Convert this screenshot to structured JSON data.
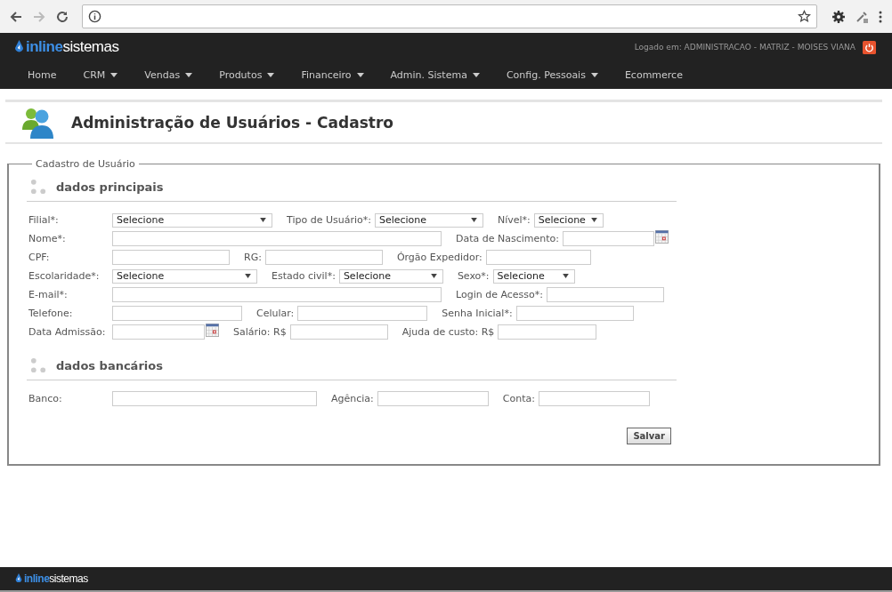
{
  "header": {
    "logo": "**inline**sistemas",
    "logged_in": "Logado em: ADMINISTRACAO - MATRIZ - MOISES VIANA"
  },
  "nav": [
    {
      "label": "Home",
      "has_menu": false
    },
    {
      "label": "CRM",
      "has_menu": true
    },
    {
      "label": "Vendas",
      "has_menu": true
    },
    {
      "label": "Produtos",
      "has_menu": true
    },
    {
      "label": "Financeiro",
      "has_menu": true
    },
    {
      "label": "Admin. Sistema",
      "has_menu": true
    },
    {
      "label": "Config. Pessoais",
      "has_menu": true
    },
    {
      "label": "Ecommerce",
      "has_menu": false
    }
  ],
  "page_title": "Administração de Usuários - Cadastro",
  "form": {
    "legend": "Cadastro de Usuário",
    "sections": [
      {
        "title": "dados principais",
        "rows": [
          [
            {
              "label": "Filial*:",
              "kind": "select",
              "value": "Selecione"
            },
            {
              "label": "Tipo de Usuário*:",
              "kind": "select",
              "value": "Selecione"
            },
            {
              "label": "Nível*:",
              "kind": "select",
              "value": "Selecione"
            }
          ],
          [
            {
              "label": "Nome*:",
              "kind": "text"
            },
            {
              "label": "Data de Nascimento:",
              "kind": "date"
            }
          ],
          [
            {
              "label": "CPF:",
              "kind": "text"
            },
            {
              "label": "RG:",
              "kind": "text"
            },
            {
              "label": "Órgão Expedidor:",
              "kind": "text"
            }
          ],
          [
            {
              "label": "Escolaridade*:",
              "kind": "select",
              "value": "Selecione"
            },
            {
              "label": "Estado civil*:",
              "kind": "select",
              "value": "Selecione"
            },
            {
              "label": "Sexo*:",
              "kind": "select",
              "value": "Selecione"
            }
          ],
          [
            {
              "label": "E-mail*:",
              "kind": "text"
            },
            {
              "label": "Login de Acesso*:",
              "kind": "text"
            }
          ],
          [
            {
              "label": "Telefone:",
              "kind": "text"
            },
            {
              "label": "Celular:",
              "kind": "text"
            },
            {
              "label": "Senha Inicial*:",
              "kind": "text"
            }
          ],
          [
            {
              "label": "Data Admissão:",
              "kind": "date"
            },
            {
              "label": "Salário: R$",
              "kind": "text"
            },
            {
              "label": "Ajuda de custo: R$",
              "kind": "text"
            }
          ]
        ]
      },
      {
        "title": "dados bancários",
        "rows": [
          [
            {
              "label": "Banco:",
              "kind": "text"
            },
            {
              "label": "Agência:",
              "kind": "text"
            },
            {
              "label": "Conta:",
              "kind": "text"
            }
          ]
        ]
      }
    ],
    "submit": "Salvar"
  },
  "footer": {
    "logo": "**inline**sistemas"
  }
}
